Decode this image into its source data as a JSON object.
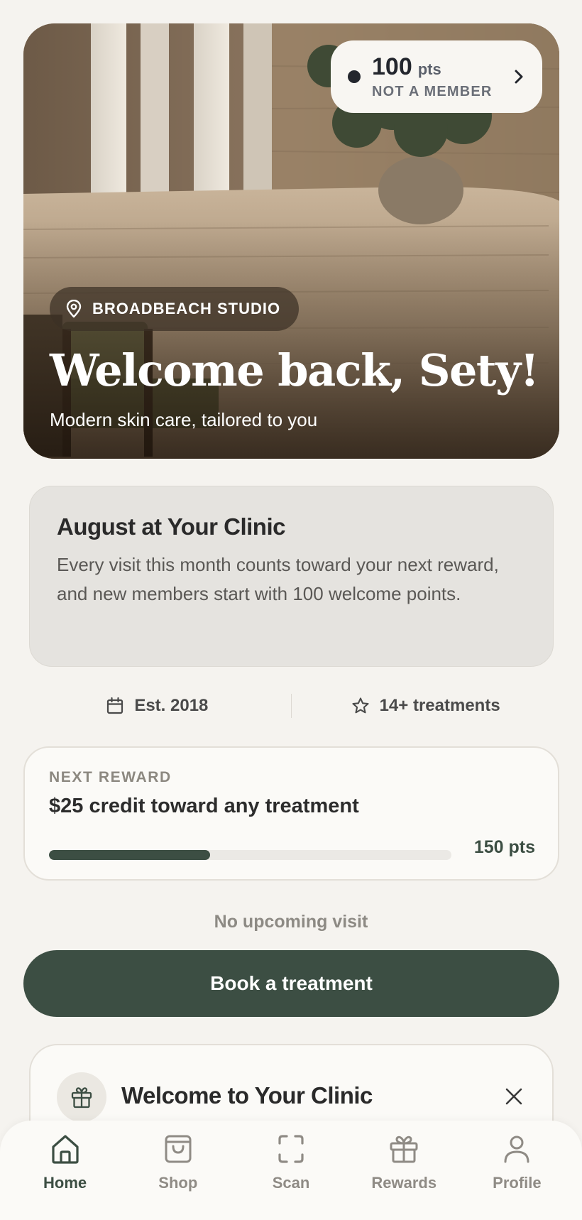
{
  "hero": {
    "points": {
      "value": "100",
      "unit": "pts",
      "status": "NOT A MEMBER"
    },
    "location": "BROADBEACH STUDIO",
    "title": "Welcome back, Sety!",
    "subtitle": "Modern skin care, tailored to you"
  },
  "promo": {
    "title": "August at Your Clinic",
    "body": "Every visit this month counts toward your next reward, and new members start with 100 welcome points."
  },
  "stats": [
    {
      "icon": "calendar-icon",
      "label": "Est. 2018"
    },
    {
      "icon": "star-icon",
      "label": "14+ treatments"
    }
  ],
  "reward": {
    "kicker": "NEXT REWARD",
    "title": "$25 credit toward any treatment",
    "progress_fraction": 0.4,
    "points_label": "150 pts"
  },
  "visit": {
    "status": "No upcoming visit",
    "book_label": "Book a treatment"
  },
  "welcome_card": {
    "title": "Welcome to Your Clinic",
    "icon": "gift-icon"
  },
  "nav": [
    {
      "label": "Home",
      "icon": "home-icon",
      "active": true
    },
    {
      "label": "Shop",
      "icon": "bag-icon",
      "active": false
    },
    {
      "label": "Scan",
      "icon": "scan-icon",
      "active": false
    },
    {
      "label": "Rewards",
      "icon": "gift-icon",
      "active": false
    },
    {
      "label": "Profile",
      "icon": "user-icon",
      "active": false
    }
  ],
  "colors": {
    "accent": "#3c4e43",
    "background": "#f5f3ef",
    "card": "#fbfaf7"
  }
}
